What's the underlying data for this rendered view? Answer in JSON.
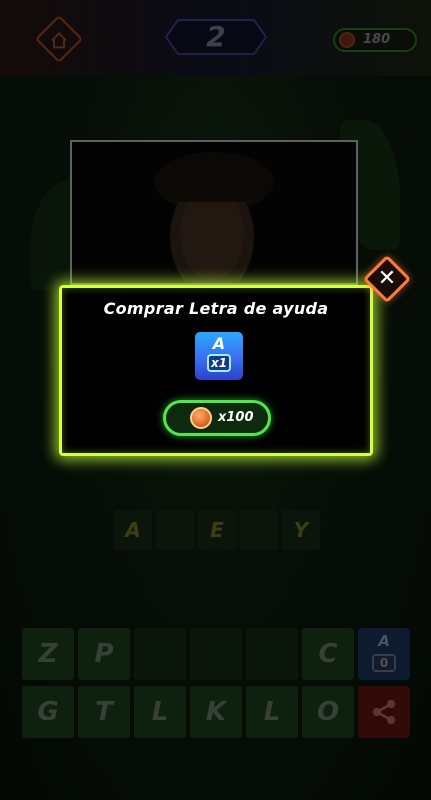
{
  "header": {
    "level": "2",
    "coins": "180"
  },
  "answer": {
    "slots": [
      "A",
      "",
      "E",
      "",
      "Y"
    ]
  },
  "keyboard": {
    "row1": [
      "Z",
      "P",
      "",
      "",
      "",
      "C"
    ],
    "row2": [
      "G",
      "T",
      "L",
      "K",
      "L",
      "O"
    ],
    "hint_letter": "A",
    "hint_count": "0"
  },
  "modal": {
    "title": "Comprar Letra de ayuda",
    "hint_letter": "A",
    "hint_qty": "x1",
    "price": "x100"
  },
  "colors": {
    "modal_border": "#d6ff3c",
    "buy_border": "#4ee84e",
    "close_border": "#ff7a3c"
  }
}
